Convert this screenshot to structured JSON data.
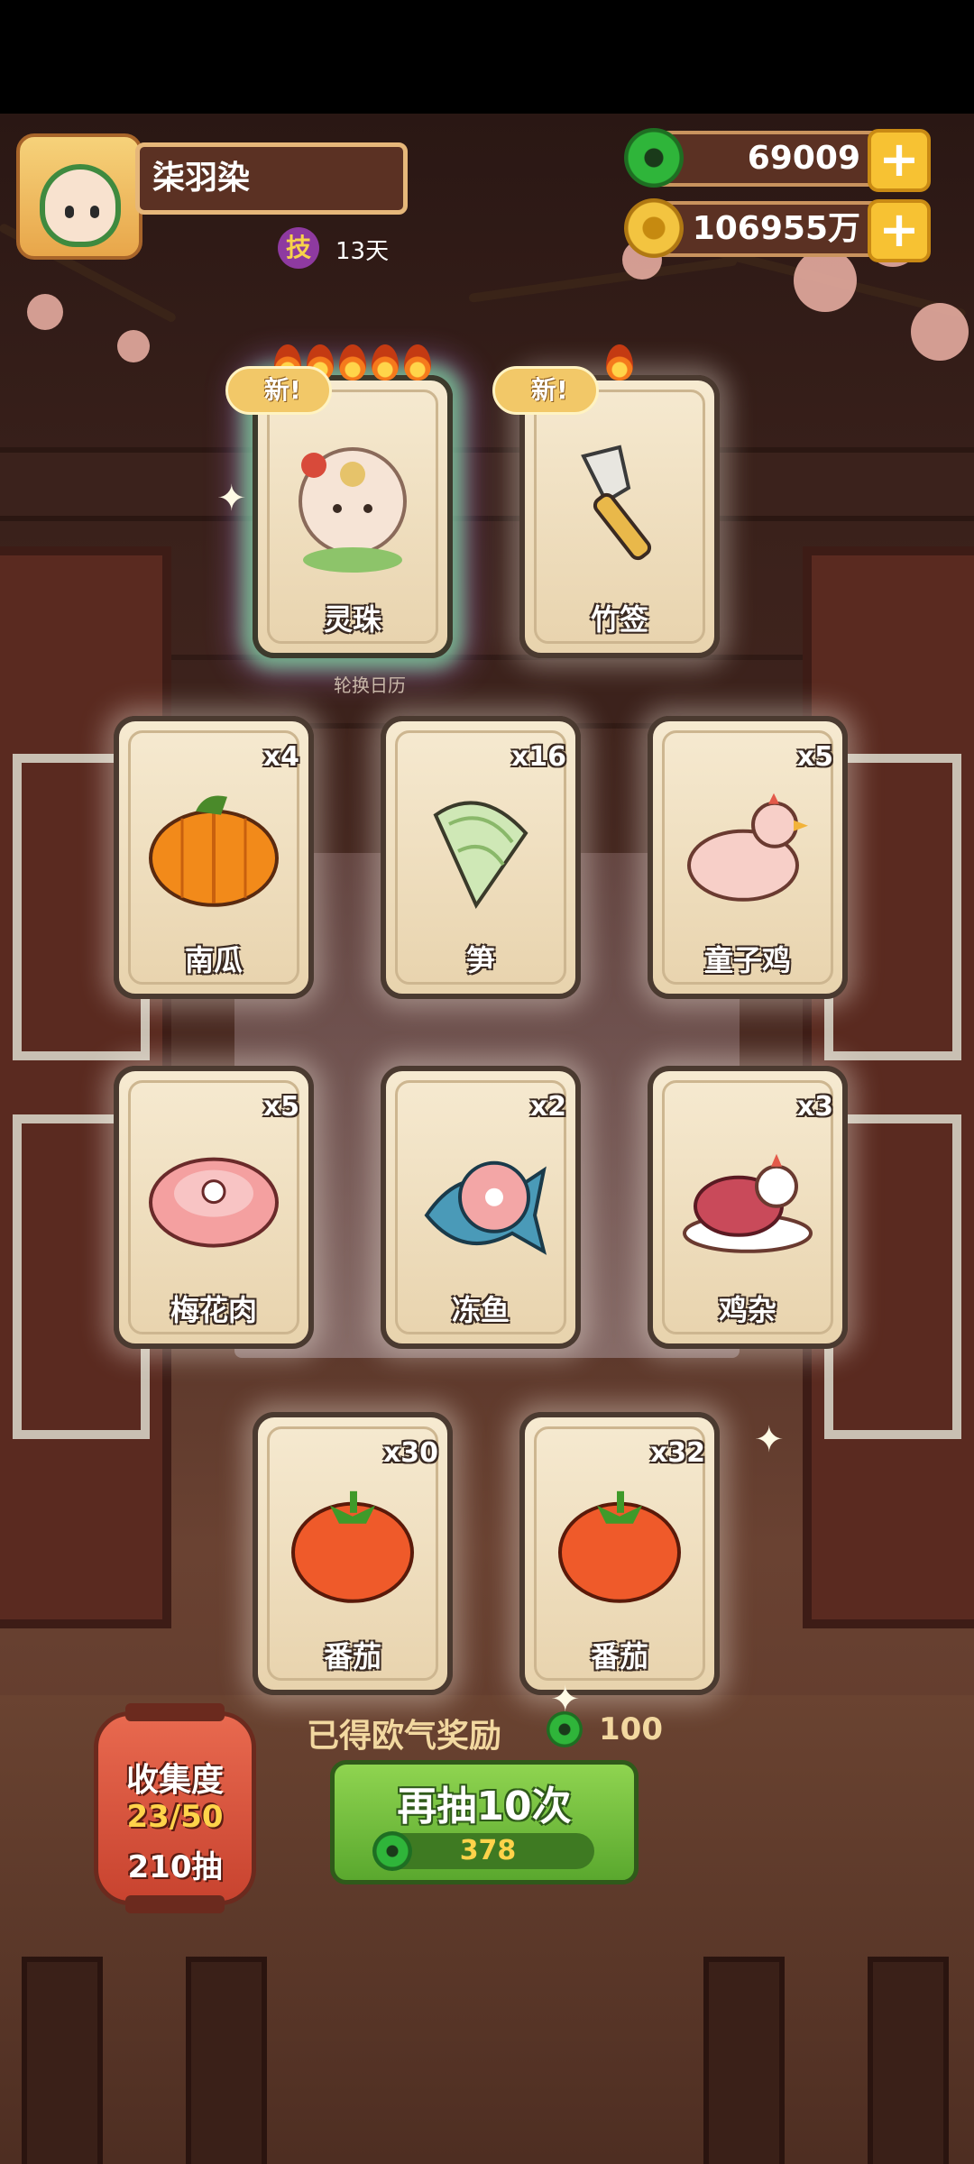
{
  "player": {
    "name": "柒羽染",
    "skill_badge": "技",
    "skill_days": "13天"
  },
  "currencies": [
    {
      "name": "jade",
      "value": "69009"
    },
    {
      "name": "coin",
      "value": "106955万"
    }
  ],
  "caption_under_top": "轮换日历",
  "cards": [
    {
      "label": "灵珠",
      "count": "",
      "new": true,
      "new_label": "新!",
      "flames": 5,
      "rarity": "rainbow"
    },
    {
      "label": "竹签",
      "count": "",
      "new": true,
      "new_label": "新!",
      "flames": 1,
      "rarity": "normal"
    },
    {
      "label": "南瓜",
      "count": "x4"
    },
    {
      "label": "笋",
      "count": "x16"
    },
    {
      "label": "童子鸡",
      "count": "x5"
    },
    {
      "label": "梅花肉",
      "count": "x5"
    },
    {
      "label": "冻鱼",
      "count": "x2"
    },
    {
      "label": "鸡杂",
      "count": "x3"
    },
    {
      "label": "番茄",
      "count": "x30"
    },
    {
      "label": "番茄",
      "count": "x32"
    }
  ],
  "collection": {
    "title": "收集度",
    "progress": "23/50",
    "draws": "210抽"
  },
  "luck_reward": {
    "label": "已得欧气奖励",
    "value": "100"
  },
  "draw_button": {
    "label": "再抽10次",
    "cost": "378"
  },
  "colors": {
    "accent_green": "#5aa82e",
    "gold": "#f7c233",
    "card_bg": "#f6ead1"
  }
}
